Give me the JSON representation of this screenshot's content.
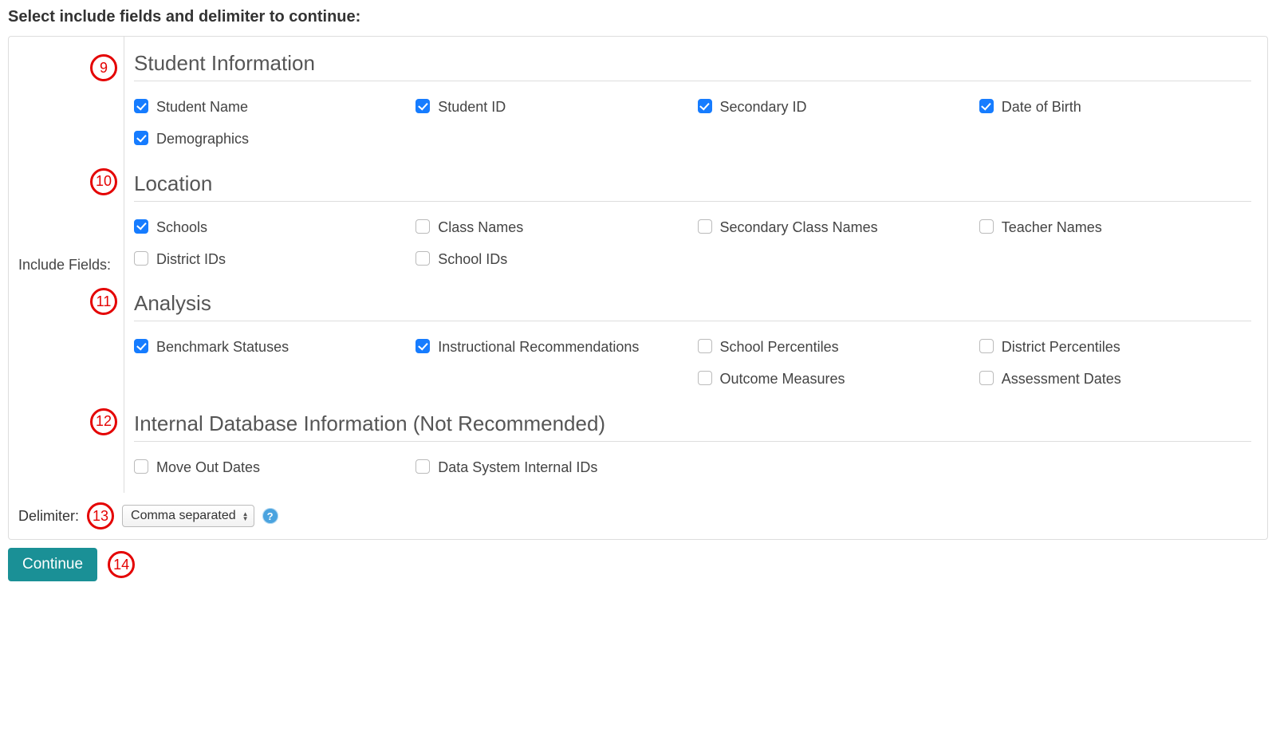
{
  "page_title": "Select include fields and delimiter to continue:",
  "include_fields_label": "Include Fields:",
  "sections": {
    "student_info": {
      "title": "Student Information",
      "fields": {
        "student_name": "Student Name",
        "student_id": "Student ID",
        "secondary_id": "Secondary ID",
        "dob": "Date of Birth",
        "demographics": "Demographics"
      }
    },
    "location": {
      "title": "Location",
      "fields": {
        "schools": "Schools",
        "class_names": "Class Names",
        "secondary_class_names": "Secondary Class Names",
        "teacher_names": "Teacher Names",
        "district_ids": "District IDs",
        "school_ids": "School IDs"
      }
    },
    "analysis": {
      "title": "Analysis",
      "fields": {
        "benchmark_statuses": "Benchmark Statuses",
        "instructional_recs": "Instructional Recommendations",
        "school_percentiles": "School Percentiles",
        "district_percentiles": "District Percentiles",
        "outcome_measures": "Outcome Measures",
        "assessment_dates": "Assessment Dates"
      }
    },
    "internal": {
      "title": "Internal Database Information (Not Recommended)",
      "fields": {
        "move_out_dates": "Move Out Dates",
        "data_system_ids": "Data System Internal IDs"
      }
    }
  },
  "delimiter": {
    "label": "Delimiter:",
    "selected": "Comma separated"
  },
  "continue_label": "Continue",
  "annotations": {
    "a9": "9",
    "a10": "10",
    "a11": "11",
    "a12": "12",
    "a13": "13",
    "a14": "14"
  }
}
